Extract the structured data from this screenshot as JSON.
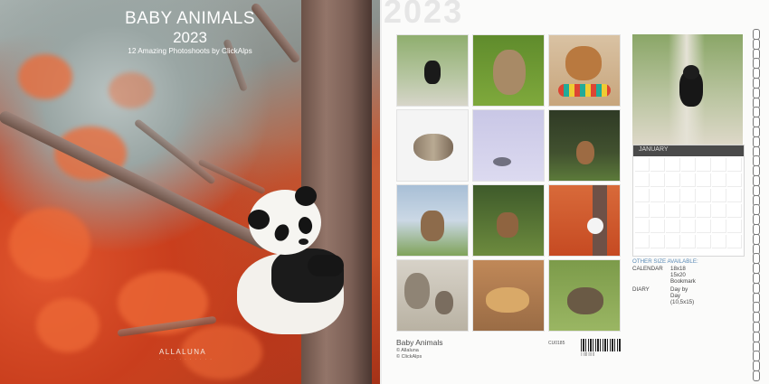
{
  "front": {
    "title": "BABY ANIMALS",
    "year": "2023",
    "subtitle": "12 Amazing Photoshoots by ClickAlps",
    "logo": "ALLALUNA"
  },
  "back": {
    "watermark_year": "2023",
    "calendar_month": "JANUARY",
    "other_sizes_heading": "OTHER SIZE AVAILABLE:",
    "sizes": [
      {
        "label": "CALENDAR",
        "value": "18x18"
      },
      {
        "label": "",
        "value": "15x20"
      },
      {
        "label": "",
        "value": "Bookmark"
      },
      {
        "label": "DIARY",
        "value": "Day by Day (10,5x15)"
      }
    ],
    "brand": "Baby Animals",
    "copyrights": [
      "© Allaluna",
      "© ClickAlps"
    ],
    "product_code": "CU0185"
  }
}
